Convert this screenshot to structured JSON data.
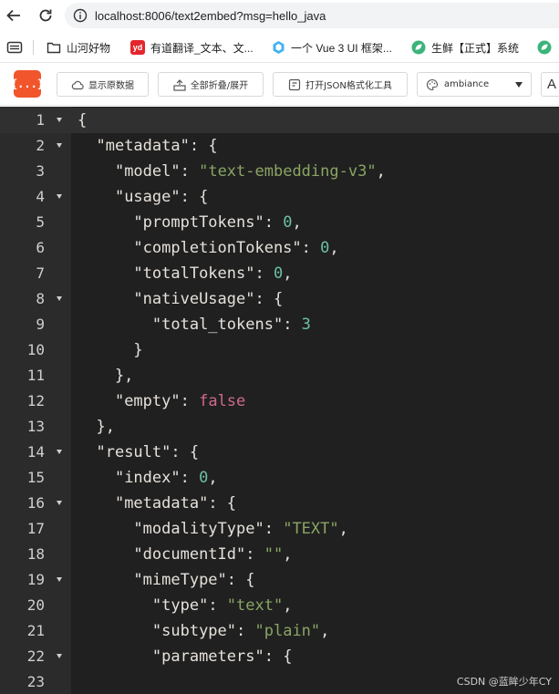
{
  "browser": {
    "url": "localhost:8006/text2embed?msg=hello_java",
    "bookmarks": [
      {
        "label": "山河好物",
        "icon": "folder-icon"
      },
      {
        "label": "有道翻译_文本、文...",
        "icon": "youdao-icon"
      },
      {
        "label": "一个 Vue 3 UI 框架...",
        "icon": "vue-cube-icon"
      },
      {
        "label": "生鲜【正式】系统",
        "icon": "leaf-icon"
      }
    ],
    "youdao_icon_text": "yd"
  },
  "toolbar": {
    "logo_text": "{...}",
    "show_raw_label": "显示原数据",
    "fold_all_label": "全部折叠/展开",
    "open_tool_label": "打开JSON格式化工具",
    "theme_value": "ambiance",
    "cut_text": "A"
  },
  "editor": {
    "active_line": 1,
    "lines": [
      {
        "n": "1",
        "fold": true,
        "tokens": [
          {
            "t": "punc",
            "v": "{"
          }
        ]
      },
      {
        "n": "2",
        "fold": true,
        "tokens": [
          {
            "t": "punc",
            "v": "  "
          },
          {
            "t": "key",
            "v": "\"metadata\""
          },
          {
            "t": "punc",
            "v": ": {"
          }
        ]
      },
      {
        "n": "3",
        "fold": false,
        "tokens": [
          {
            "t": "punc",
            "v": "    "
          },
          {
            "t": "key",
            "v": "\"model\""
          },
          {
            "t": "punc",
            "v": ": "
          },
          {
            "t": "str",
            "v": "\"text-embedding-v3\""
          },
          {
            "t": "punc",
            "v": ","
          }
        ]
      },
      {
        "n": "4",
        "fold": true,
        "tokens": [
          {
            "t": "punc",
            "v": "    "
          },
          {
            "t": "key",
            "v": "\"usage\""
          },
          {
            "t": "punc",
            "v": ": {"
          }
        ]
      },
      {
        "n": "5",
        "fold": false,
        "tokens": [
          {
            "t": "punc",
            "v": "      "
          },
          {
            "t": "key",
            "v": "\"promptTokens\""
          },
          {
            "t": "punc",
            "v": ": "
          },
          {
            "t": "num",
            "v": "0"
          },
          {
            "t": "punc",
            "v": ","
          }
        ]
      },
      {
        "n": "6",
        "fold": false,
        "tokens": [
          {
            "t": "punc",
            "v": "      "
          },
          {
            "t": "key",
            "v": "\"completionTokens\""
          },
          {
            "t": "punc",
            "v": ": "
          },
          {
            "t": "num",
            "v": "0"
          },
          {
            "t": "punc",
            "v": ","
          }
        ]
      },
      {
        "n": "7",
        "fold": false,
        "tokens": [
          {
            "t": "punc",
            "v": "      "
          },
          {
            "t": "key",
            "v": "\"totalTokens\""
          },
          {
            "t": "punc",
            "v": ": "
          },
          {
            "t": "num",
            "v": "0"
          },
          {
            "t": "punc",
            "v": ","
          }
        ]
      },
      {
        "n": "8",
        "fold": true,
        "tokens": [
          {
            "t": "punc",
            "v": "      "
          },
          {
            "t": "key",
            "v": "\"nativeUsage\""
          },
          {
            "t": "punc",
            "v": ": {"
          }
        ]
      },
      {
        "n": "9",
        "fold": false,
        "tokens": [
          {
            "t": "punc",
            "v": "        "
          },
          {
            "t": "key",
            "v": "\"total_tokens\""
          },
          {
            "t": "punc",
            "v": ": "
          },
          {
            "t": "num",
            "v": "3"
          }
        ]
      },
      {
        "n": "10",
        "fold": false,
        "tokens": [
          {
            "t": "punc",
            "v": "      }"
          }
        ]
      },
      {
        "n": "11",
        "fold": false,
        "tokens": [
          {
            "t": "punc",
            "v": "    },"
          }
        ]
      },
      {
        "n": "12",
        "fold": false,
        "tokens": [
          {
            "t": "punc",
            "v": "    "
          },
          {
            "t": "key",
            "v": "\"empty\""
          },
          {
            "t": "punc",
            "v": ": "
          },
          {
            "t": "bool",
            "v": "false"
          }
        ]
      },
      {
        "n": "13",
        "fold": false,
        "tokens": [
          {
            "t": "punc",
            "v": "  },"
          }
        ]
      },
      {
        "n": "14",
        "fold": true,
        "tokens": [
          {
            "t": "punc",
            "v": "  "
          },
          {
            "t": "key",
            "v": "\"result\""
          },
          {
            "t": "punc",
            "v": ": {"
          }
        ]
      },
      {
        "n": "15",
        "fold": false,
        "tokens": [
          {
            "t": "punc",
            "v": "    "
          },
          {
            "t": "key",
            "v": "\"index\""
          },
          {
            "t": "punc",
            "v": ": "
          },
          {
            "t": "num",
            "v": "0"
          },
          {
            "t": "punc",
            "v": ","
          }
        ]
      },
      {
        "n": "16",
        "fold": true,
        "tokens": [
          {
            "t": "punc",
            "v": "    "
          },
          {
            "t": "key",
            "v": "\"metadata\""
          },
          {
            "t": "punc",
            "v": ": {"
          }
        ]
      },
      {
        "n": "17",
        "fold": false,
        "tokens": [
          {
            "t": "punc",
            "v": "      "
          },
          {
            "t": "key",
            "v": "\"modalityType\""
          },
          {
            "t": "punc",
            "v": ": "
          },
          {
            "t": "str",
            "v": "\"TEXT\""
          },
          {
            "t": "punc",
            "v": ","
          }
        ]
      },
      {
        "n": "18",
        "fold": false,
        "tokens": [
          {
            "t": "punc",
            "v": "      "
          },
          {
            "t": "key",
            "v": "\"documentId\""
          },
          {
            "t": "punc",
            "v": ": "
          },
          {
            "t": "str",
            "v": "\"\""
          },
          {
            "t": "punc",
            "v": ","
          }
        ]
      },
      {
        "n": "19",
        "fold": true,
        "tokens": [
          {
            "t": "punc",
            "v": "      "
          },
          {
            "t": "key",
            "v": "\"mimeType\""
          },
          {
            "t": "punc",
            "v": ": {"
          }
        ]
      },
      {
        "n": "20",
        "fold": false,
        "tokens": [
          {
            "t": "punc",
            "v": "        "
          },
          {
            "t": "key",
            "v": "\"type\""
          },
          {
            "t": "punc",
            "v": ": "
          },
          {
            "t": "str",
            "v": "\"text\""
          },
          {
            "t": "punc",
            "v": ","
          }
        ]
      },
      {
        "n": "21",
        "fold": false,
        "tokens": [
          {
            "t": "punc",
            "v": "        "
          },
          {
            "t": "key",
            "v": "\"subtype\""
          },
          {
            "t": "punc",
            "v": ": "
          },
          {
            "t": "str",
            "v": "\"plain\""
          },
          {
            "t": "punc",
            "v": ","
          }
        ]
      },
      {
        "n": "22",
        "fold": true,
        "tokens": [
          {
            "t": "punc",
            "v": "        "
          },
          {
            "t": "key",
            "v": "\"parameters\""
          },
          {
            "t": "punc",
            "v": ": {"
          }
        ]
      },
      {
        "n": "23",
        "fold": false,
        "tokens": []
      }
    ]
  },
  "watermark": "CSDN @蓝眸少年CY",
  "colors": {
    "logo_bg": "#f2552c",
    "editor_bg": "#202020",
    "gutter_bg": "#2b2b2b",
    "string": "#89a564",
    "number": "#6cc0a4",
    "boolean": "#cf6a8c"
  }
}
